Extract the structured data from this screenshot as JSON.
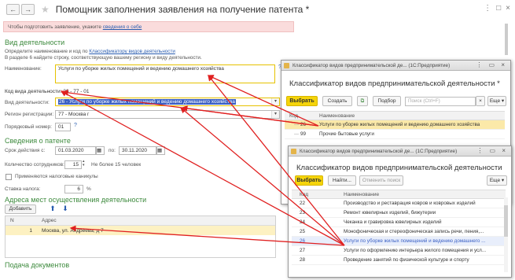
{
  "window": {
    "back_label": "←",
    "forward_label": "→",
    "star_icon": "star-icon",
    "title": "Помощник заполнения заявления на получение патента *",
    "top_icons": [
      "⋮",
      "□",
      "×"
    ]
  },
  "notice": {
    "text": "Чтобы подготовить заявление, укажите",
    "link": "сведения о себе"
  },
  "activity": {
    "section_title": "Вид деятельности",
    "hint_line1": "Определите наименование и код по",
    "hint_link": "Классификатору видов деятельности",
    "hint_line2": "В разделе 6 найдите строку, соответствующую вашему региону и виду деятельности.",
    "name_label": "Наименование:",
    "name_value": "Услуги по уборке жилых помещений и ведению домашнего хозяйства",
    "code_label": "Код вида деятельности: 26 - 77 - 01",
    "type_label": "Вид деятельности:",
    "type_value": "26 - Услуги по уборке жилых помещений и ведению домашнего хозяйства",
    "region_label": "Регион регистрации:",
    "region_value": "77 - Москва г",
    "order_label": "Порядковый номер:",
    "order_value": "01",
    "help": "?"
  },
  "patent": {
    "section_title": "Сведения о патенте",
    "term_label": "Срок действия с:",
    "term_from": "01.03.2020",
    "term_to_label": "по:",
    "term_to": "30.11.2020",
    "staff_label": "Количество сотрудников:",
    "staff_value": "15",
    "staff_hint": "Не более 15 человек",
    "holidays_label": "Применяются налоговые каникулы",
    "rate_label": "Ставка налога:",
    "rate_value": "6",
    "rate_unit": "%"
  },
  "addresses": {
    "section_title": "Адреса мест осуществления деятельности",
    "add_label": "Добавить",
    "up_icon": "arrow-up-icon",
    "down_icon": "arrow-down-icon",
    "col_n": "N",
    "col_address": "Адрес",
    "rows": [
      {
        "n": "1",
        "address": "Москва, ул. Андреева, д 7"
      }
    ]
  },
  "submit": {
    "section_title": "Подача документов"
  },
  "popup1": {
    "window_title": "Классификатор видов предпринимательской де... (1С:Предприятие)",
    "title": "Классификатор видов предпринимательской деятельности *",
    "choose_label": "Выбрать",
    "create_label": "Создать",
    "filter_label": "Подбор",
    "search_placeholder": "Поиск (Ctrl+F)",
    "more_label": "Еще ▾",
    "col_code": "Код",
    "col_name": "Наименование",
    "rows": [
      {
        "code": "26",
        "name": "Услуги по уборке жилых помещений и ведению домашнего хозяйства"
      },
      {
        "code": "99",
        "name": "Прочие бытовые услуги"
      }
    ]
  },
  "popup2": {
    "window_title": "Классификатор видов предпринимательской де... (1С:Предприятие)",
    "title": "Классификатор видов предпринимательской деятельности",
    "choose_label": "Выбрать",
    "find_label": "Найти...",
    "cancel_search_label": "Отменить поиск",
    "more_label": "Еще ▾",
    "col_code": "Код",
    "col_name": "Наименование",
    "rows": [
      {
        "code": "22",
        "name": "Производство и реставрация ковров и ковровых изделий"
      },
      {
        "code": "23",
        "name": "Ремонт ювелирных изделий, бижутерии"
      },
      {
        "code": "24",
        "name": "Чеканка и гравировка ювелирных изделий"
      },
      {
        "code": "25",
        "name": "Монофоническая и стереофоническая запись речи, пения,..."
      },
      {
        "code": "26",
        "name": "Услуги по уборке жилых помещений и ведению домашнего ..."
      },
      {
        "code": "27",
        "name": "Услуги по оформлению интерьера жилого помещения и усл..."
      },
      {
        "code": "28",
        "name": "Проведение занятий по физической культуре и спорту"
      }
    ]
  },
  "colors": {
    "section_green": "#3d8a3d",
    "accent_yellow": "#f5d40a",
    "annotation_red": "#e02020",
    "selection_blue": "#3b60c4"
  }
}
